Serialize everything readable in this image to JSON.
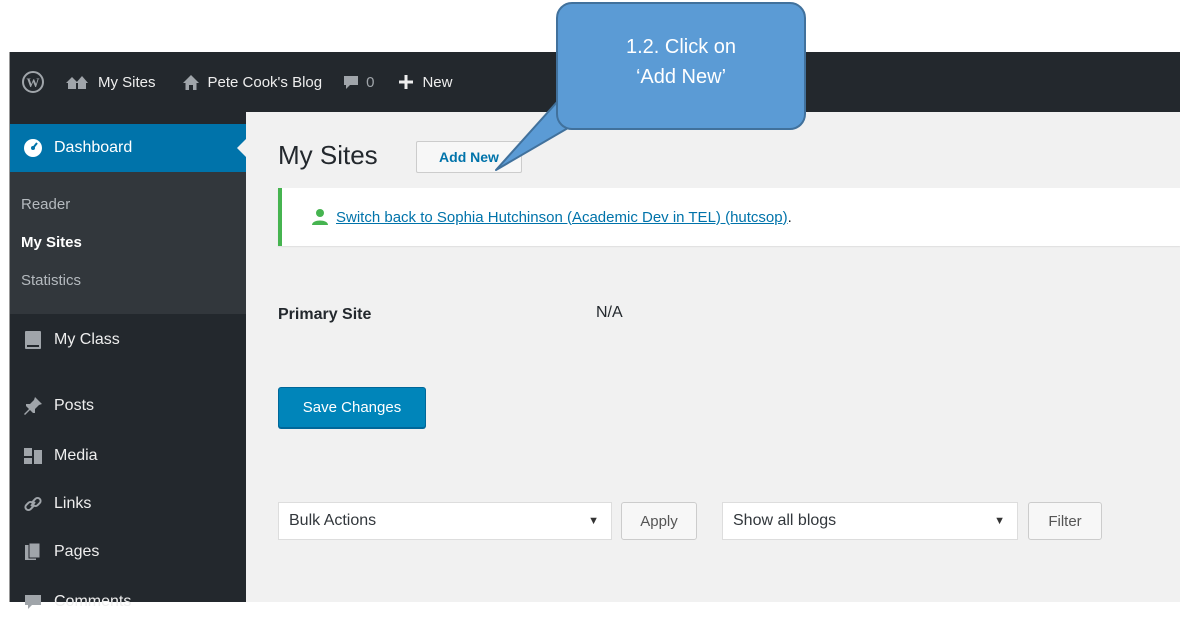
{
  "toolbar": {
    "my_sites": "My Sites",
    "site_name": "Pete Cook's Blog",
    "comments_count": "0",
    "new_label": "New"
  },
  "sidebar": {
    "dashboard": "Dashboard",
    "submenu": [
      "Reader",
      "My Sites",
      "Statistics"
    ],
    "items": [
      "My Class",
      "Posts",
      "Media",
      "Links",
      "Pages",
      "Comments"
    ]
  },
  "main": {
    "title": "My Sites",
    "add_new": "Add New",
    "notice_link": "Switch back to Sophia Hutchinson (Academic Dev in TEL) (hutcsop)",
    "notice_end": ".",
    "primary_site_label": "Primary Site",
    "primary_site_value": "N/A",
    "save_button": "Save Changes",
    "bulk_actions": "Bulk Actions",
    "apply": "Apply",
    "show_blogs": "Show all blogs",
    "filter": "Filter"
  },
  "callout": {
    "line1": "1.2. Click on",
    "line2": "‘Add New’"
  },
  "colors": {
    "adminbar": "#23282d",
    "accent": "#0073aa",
    "callout": "#5b9bd5",
    "notice_border": "#46b450"
  }
}
